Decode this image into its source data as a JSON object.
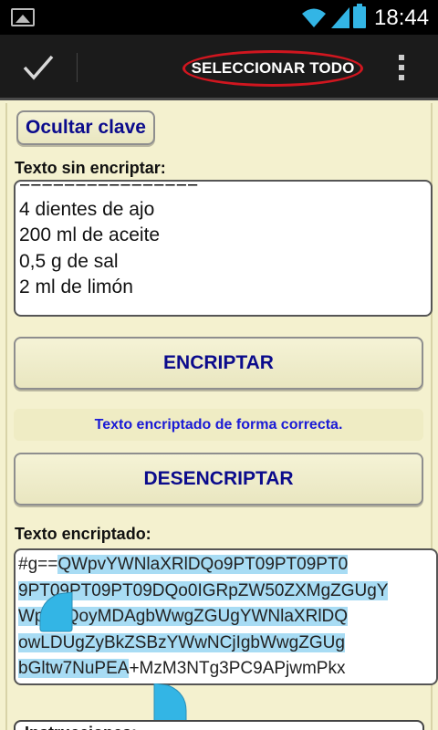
{
  "status_bar": {
    "time": "18:44"
  },
  "action_bar": {
    "done_icon": "check-icon",
    "select_all_label": "SELECCIONAR TODO",
    "overflow_icon": "overflow-menu-icon"
  },
  "main": {
    "hide_key_button": "Ocultar clave",
    "plain_label": "Texto sin encriptar:",
    "plain_lines": [
      "================",
      "4 dientes de ajo",
      "200 ml de aceite",
      "0,5 g de sal",
      "2 ml de limón"
    ],
    "encrypt_button": "ENCRIPTAR",
    "status_message": "Texto encriptado de forma correcta.",
    "decrypt_button": "DESENCRIPTAR",
    "encrypted_label": "Texto encriptado:",
    "encrypted_lines": [
      {
        "pre": "#g==",
        "sel": "QWpvYWNlaXRlDQo9PT09PT09PT0",
        "post": ""
      },
      {
        "pre": "",
        "sel": "9PT09PT09PT09DQo0IGRpZW50ZXMgZGUgY",
        "post": ""
      },
      {
        "pre": "",
        "sel": "WpvDQoyMDAgbWwgZGUgYWNlaXRlDQ",
        "post": ""
      },
      {
        "pre": "",
        "sel": "owLDUgZyBkZSBzYWwNCjIgbWwgZGUg",
        "post": ""
      },
      {
        "pre": "",
        "sel": "bGltw7NuPEA",
        "post": "+MzM3NTg3PC9APjwmPkx"
      }
    ],
    "bottom_label": "Instrucciones:"
  },
  "colors": {
    "background": "#f4f1cf",
    "button_text": "#0b0b8c",
    "status_text": "#1a1ad6",
    "selection": "#a8dcf4",
    "highlight_circle": "#d0161f",
    "handle": "#33b5e5"
  }
}
